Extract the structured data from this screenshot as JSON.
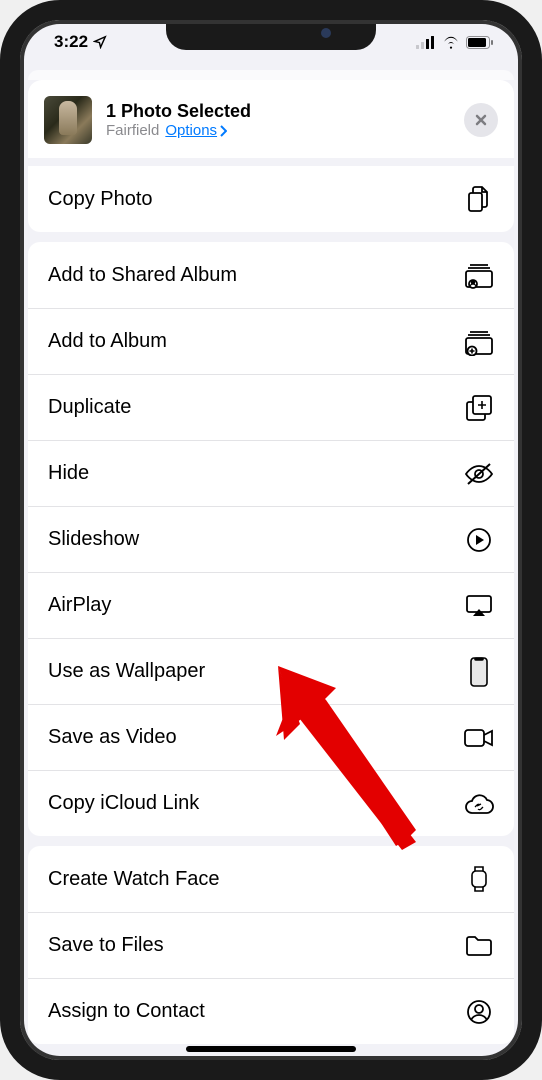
{
  "status": {
    "time": "3:22"
  },
  "header": {
    "title": "1 Photo Selected",
    "location": "Fairfield",
    "options_label": "Options"
  },
  "group1": [
    {
      "label": "Copy Photo",
      "icon": "copy-photo"
    }
  ],
  "group2": [
    {
      "label": "Add to Shared Album",
      "icon": "shared-album"
    },
    {
      "label": "Add to Album",
      "icon": "add-album"
    },
    {
      "label": "Duplicate",
      "icon": "duplicate"
    },
    {
      "label": "Hide",
      "icon": "hide"
    },
    {
      "label": "Slideshow",
      "icon": "play-circle"
    },
    {
      "label": "AirPlay",
      "icon": "airplay"
    },
    {
      "label": "Use as Wallpaper",
      "icon": "phone"
    },
    {
      "label": "Save as Video",
      "icon": "video"
    },
    {
      "label": "Copy iCloud Link",
      "icon": "cloud-link"
    }
  ],
  "group3": [
    {
      "label": "Create Watch Face",
      "icon": "watch"
    },
    {
      "label": "Save to Files",
      "icon": "folder"
    },
    {
      "label": "Assign to Contact",
      "icon": "contact"
    }
  ]
}
